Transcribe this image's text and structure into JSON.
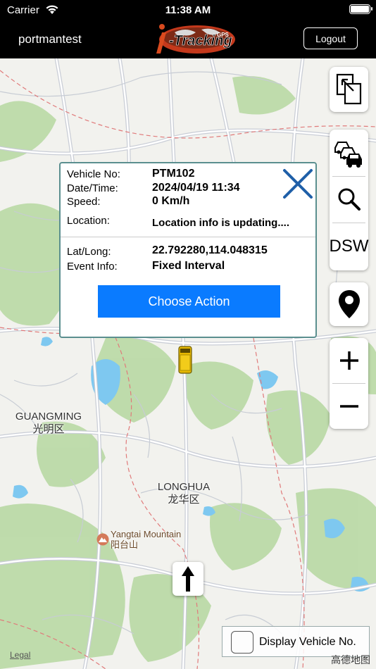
{
  "status_bar": {
    "carrier": "Carrier",
    "time": "11:38 AM"
  },
  "header": {
    "username": "portmantest",
    "logout_label": "Logout"
  },
  "map": {
    "labels": {
      "guangming_en": "GUANGMING",
      "guangming_zh": "光明区",
      "longhua_en": "LONGHUA",
      "longhua_zh": "龙华区",
      "yangtai_en": "Yangtai Mountain",
      "yangtai_zh": "阳台山"
    },
    "legal": "Legal",
    "provider": "高德地图"
  },
  "popup": {
    "vehicle_no_label": "Vehicle No:",
    "vehicle_no": "PTM102",
    "datetime_label": "Date/Time:",
    "datetime": "2024/04/19 11:34",
    "speed_label": "Speed:",
    "speed": "0 Km/h",
    "location_label": "Location:",
    "location": "Location info is updating....",
    "latlong_label": "Lat/Long:",
    "latlong": "22.792280,114.048315",
    "event_label": "Event Info:",
    "event": "Fixed Interval",
    "action_label": "Choose Action"
  },
  "controls": {
    "dsw_label": "DSW"
  },
  "display_vehicle_no": {
    "label": "Display Vehicle No.",
    "checked": false
  },
  "colors": {
    "accent": "#0a7bff",
    "close_icon": "#1f5fa8",
    "map_bg": "#f2f2ee",
    "green": "#b9d9a4",
    "water": "#7ec8f0"
  }
}
